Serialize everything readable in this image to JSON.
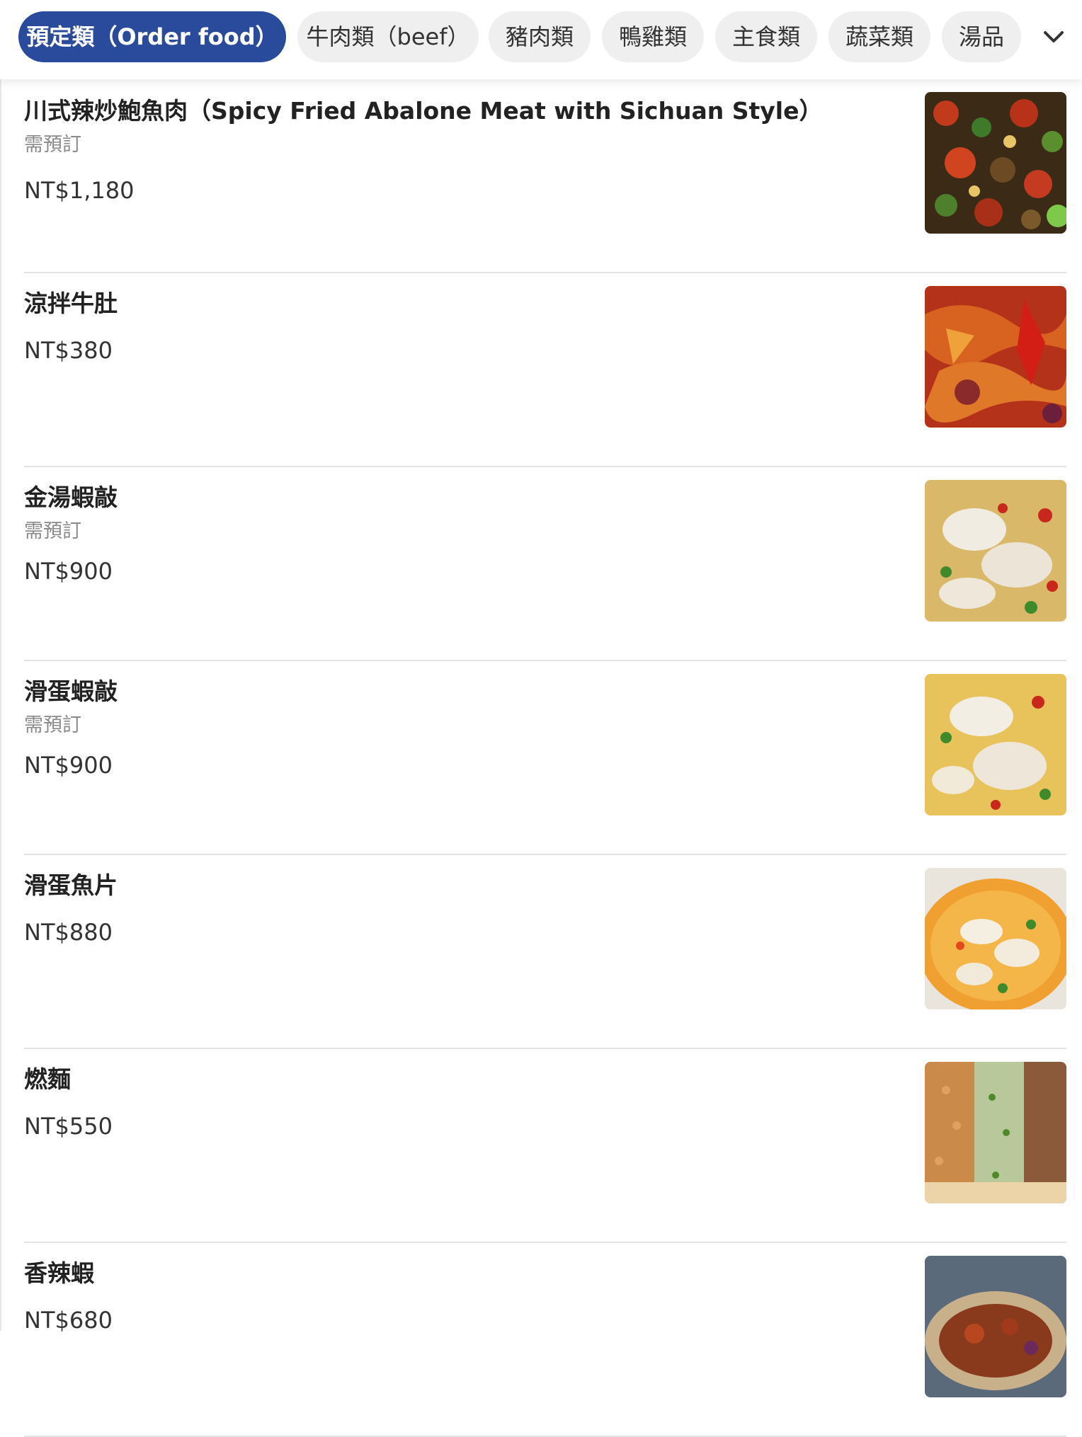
{
  "categories": [
    {
      "label": "預定類（Order food）",
      "active": true
    },
    {
      "label": "牛肉類（beef）",
      "active": false
    },
    {
      "label": "豬肉類",
      "active": false
    },
    {
      "label": "鴨雞類",
      "active": false
    },
    {
      "label": "主食類",
      "active": false
    },
    {
      "label": "蔬菜類",
      "active": false
    },
    {
      "label": "湯品",
      "active": false
    }
  ],
  "expand_icon": "chevron-down-icon",
  "colors": {
    "accent": "#2a4a9c",
    "chip_bg": "#efefef",
    "note_text": "#8a8a8a",
    "divider": "#e3e3e3"
  },
  "menu_items": [
    {
      "name": "川式辣炒鮑魚肉（Spicy Fried Abalone Meat with Sichuan Style）",
      "note": "需預訂",
      "price": "NT$1,180",
      "photo": "spicy-abalone-photo"
    },
    {
      "name": "涼拌牛肚",
      "note": "",
      "price": "NT$380",
      "photo": "cold-beef-tripe-photo"
    },
    {
      "name": "金湯蝦敲",
      "note": "需預訂",
      "price": "NT$900",
      "photo": "golden-soup-shrimp-photo"
    },
    {
      "name": "滑蛋蝦敲",
      "note": "需預訂",
      "price": "NT$900",
      "photo": "egg-shrimp-photo"
    },
    {
      "name": "滑蛋魚片",
      "note": "",
      "price": "NT$880",
      "photo": "egg-fish-slice-photo"
    },
    {
      "name": "燃麵",
      "note": "",
      "price": "NT$550",
      "photo": "burning-noodles-photo"
    },
    {
      "name": "香辣蝦",
      "note": "",
      "price": "NT$680",
      "photo": "spicy-shrimp-photo"
    }
  ]
}
